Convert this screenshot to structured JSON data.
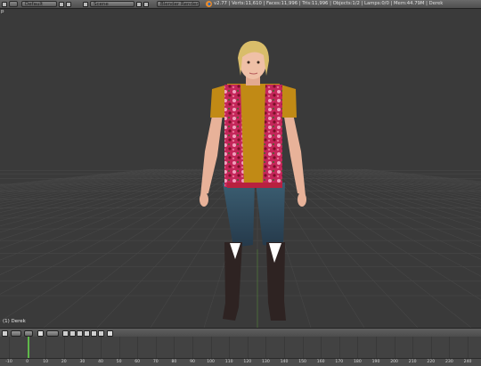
{
  "header": {
    "editor_label": "Default",
    "scene_label": "Scene",
    "engine_label": "Blender Render",
    "stats": "v2.77 | Verts:11,610 | Faces:11,996 | Tris:11,996 | Objects:1/2 | Lamps:0/0 | Mem:44.79M | Derek"
  },
  "viewport": {
    "corner_label": "p",
    "selected_object_label": "(1) Derek",
    "grid_color": "#4a4a4a",
    "y_axis_color": "#5a8a3a"
  },
  "timeline": {
    "current_frame_marker_color": "#5fb84a",
    "ticks": [
      "-10",
      "0",
      "10",
      "20",
      "30",
      "40",
      "50",
      "60",
      "70",
      "80",
      "90",
      "100",
      "110",
      "120",
      "130",
      "140",
      "150",
      "160",
      "170",
      "180",
      "190",
      "200",
      "210",
      "220",
      "230",
      "240",
      "250"
    ]
  }
}
